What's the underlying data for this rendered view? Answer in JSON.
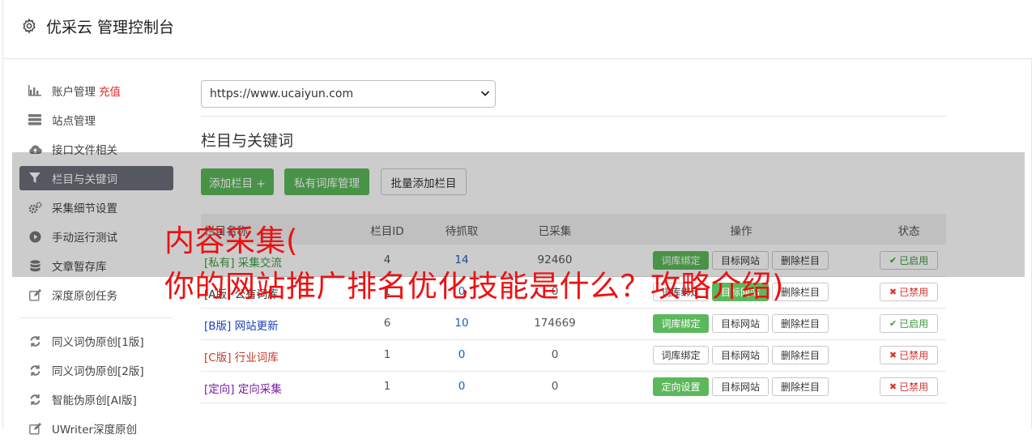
{
  "header": {
    "title": "优采云 管理控制台",
    "icon": "gear-icon"
  },
  "sidebar": {
    "items": [
      {
        "label": "账户管理",
        "extra": "充值",
        "icon": "bar-chart-icon"
      },
      {
        "label": "站点管理",
        "icon": "server-icon"
      },
      {
        "label": "接口文件相关",
        "icon": "cloud-upload-icon"
      },
      {
        "label": "栏目与关键词",
        "icon": "filter-icon",
        "active": true
      },
      {
        "label": "采集细节设置",
        "icon": "gears-icon"
      },
      {
        "label": "手动运行测试",
        "icon": "play-icon"
      },
      {
        "label": "文章暂存库",
        "icon": "database-icon"
      },
      {
        "label": "深度原创任务",
        "icon": "edit-icon"
      }
    ],
    "tools": [
      {
        "label": "同义词伪原创[1版]",
        "icon": "refresh-icon"
      },
      {
        "label": "同义词伪原创[2版]",
        "icon": "refresh-icon"
      },
      {
        "label": "智能伪原创[AI版]",
        "icon": "refresh-icon"
      },
      {
        "label": "UWriter深度原创",
        "icon": "edit-icon"
      }
    ]
  },
  "main": {
    "site_select_value": "https://www.ucaiyun.com",
    "section_title": "栏目与关键词",
    "buttons": {
      "add_column": "添加栏目 +",
      "private_lib": "私有词库管理",
      "batch_add": "批量添加栏目"
    },
    "table": {
      "headers": {
        "name": "栏目名称",
        "id": "栏目ID",
        "pending": "待抓取",
        "collected": "已采集",
        "ops": "操作",
        "status": "状态"
      },
      "rows": [
        {
          "tag": "[私有]",
          "name": "采集交流",
          "color": "#3c9a3c",
          "id": "4",
          "pending": "14",
          "collected": "92460",
          "op1": "词库绑定",
          "op1_green": true,
          "op2": "目标网站",
          "op3": "删除栏目",
          "status": "已启用",
          "enabled": true
        },
        {
          "tag": "[A版]",
          "name": "公有词库",
          "color": "#333333",
          "id": "1",
          "pending": "0",
          "collected": "0",
          "op1": "词库绑定",
          "op1_green": false,
          "op2": "目标网站",
          "op2_green": true,
          "op3": "删除栏目",
          "status": "已禁用",
          "enabled": false
        },
        {
          "tag": "[B版]",
          "name": "网站更新",
          "color": "#1a3fb8",
          "id": "6",
          "pending": "10",
          "collected": "174669",
          "op1": "词库绑定",
          "op1_green": true,
          "op2": "目标网站",
          "op3": "删除栏目",
          "status": "已启用",
          "enabled": true
        },
        {
          "tag": "[C版]",
          "name": "行业词库",
          "color": "#c0392b",
          "id": "1",
          "pending": "0",
          "collected": "0",
          "op1": "词库绑定",
          "op1_green": false,
          "op2": "目标网站",
          "op3": "删除栏目",
          "status": "已禁用",
          "enabled": false
        },
        {
          "tag": "[定向]",
          "name": "定向采集",
          "color": "#7a1fa2",
          "id": "1",
          "pending": "0",
          "collected": "0",
          "op1": "定向设置",
          "op1_green": true,
          "op2": "目标网站",
          "op3": "删除栏目",
          "status": "已禁用",
          "enabled": false
        }
      ]
    }
  },
  "overlay_text": {
    "line1": "内容采集(",
    "line2": "你的网站推广排名优化技能是什么？攻略介绍)"
  },
  "colors": {
    "accent_green": "#5cb85c",
    "active_nav": "#6b6f78",
    "recharge_red": "#e02a2a",
    "overlay_red": "#ee1111",
    "pending_blue": "#1a5fb4"
  }
}
